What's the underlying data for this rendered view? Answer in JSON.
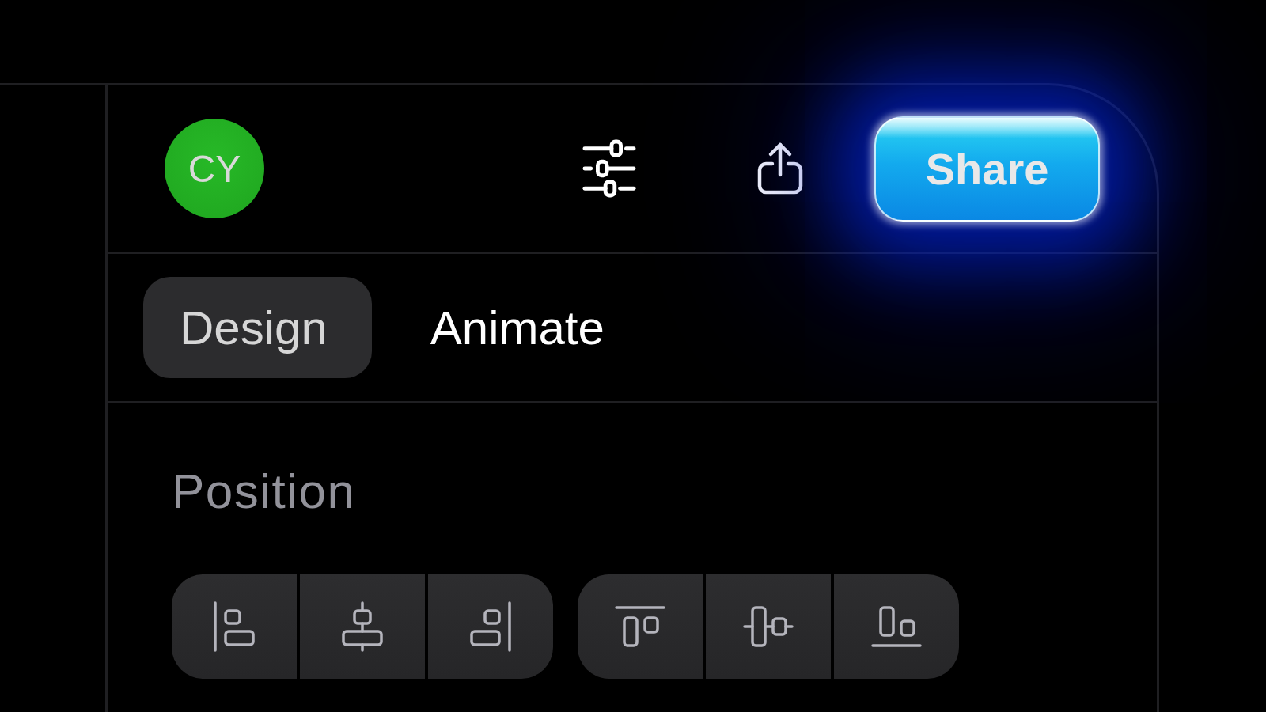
{
  "header": {
    "avatar": {
      "initials": "CY"
    },
    "share_button": {
      "label": "Share"
    }
  },
  "tabs": [
    {
      "label": "Design",
      "selected": true
    },
    {
      "label": "Animate",
      "selected": false
    }
  ],
  "position": {
    "title": "Position",
    "horizontal_align": [
      {
        "kind": "left"
      },
      {
        "kind": "center"
      },
      {
        "kind": "right"
      }
    ],
    "vertical_align": [
      {
        "kind": "top"
      },
      {
        "kind": "middle"
      },
      {
        "kind": "bottom"
      }
    ]
  }
}
